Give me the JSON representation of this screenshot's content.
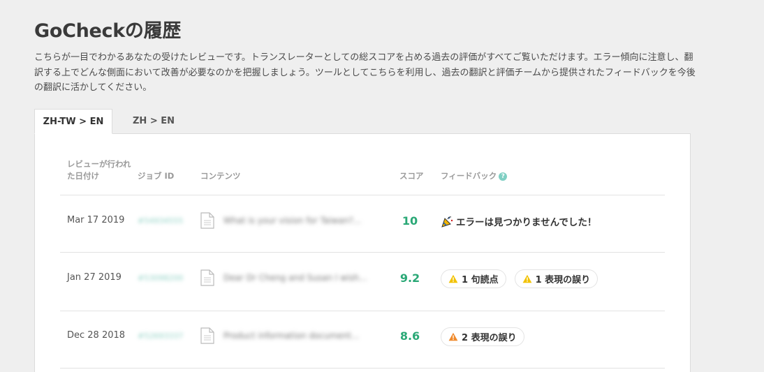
{
  "page": {
    "title": "GoCheckの履歴",
    "intro": "こちらが一目でわかるあなたの受けたレビューです。トランスレーターとしての総スコアを占める過去の評価がすべてご覧いただけます。エラー傾向に注意し、翻訳する上でどんな側面において改善が必要なのかを把握しましょう。ツールとしてこちらを利用し、過去の翻訳と評価チームから提供されたフィードバックを今後の翻訳に活かしてください。"
  },
  "tabs": [
    {
      "label": "ZH-TW > EN",
      "active": true
    },
    {
      "label": "ZH > EN",
      "active": false
    }
  ],
  "table": {
    "headers": {
      "date": "レビューが行われた日付け",
      "job_id": "ジョブ ID",
      "content": "コンテンツ",
      "score": "スコア",
      "feedback": "フィードバック"
    },
    "rows": [
      {
        "date": "Mar 17 2019",
        "job_id": "#54934555",
        "content": "What is your vision for Taiwan?...",
        "score": "10",
        "feedback_text": "エラーは見つかりませんでした！",
        "badges": []
      },
      {
        "date": "Jan 27 2019",
        "job_id": "#53098200",
        "content": "Dear Dr Cheng and Susan I wish...",
        "score": "9.2",
        "feedback_text": "",
        "badges": [
          {
            "label": "1 句読点",
            "level": "yellow"
          },
          {
            "label": "1 表現の誤り",
            "level": "yellow"
          }
        ]
      },
      {
        "date": "Dec 28 2018",
        "job_id": "#52693337",
        "content": "Product information document...",
        "score": "8.6",
        "feedback_text": "",
        "badges": [
          {
            "label": "2 表現の誤り",
            "level": "orange"
          }
        ]
      }
    ]
  },
  "colors": {
    "score": "#2aa876",
    "warn_yellow": "#f2c200",
    "warn_orange": "#f08a2c",
    "help_icon": "#7fcfc3"
  },
  "icons": {
    "celebrate": "party-popper-icon",
    "doc": "document-icon",
    "warn": "warning-triangle-icon",
    "help": "help-circle-icon"
  }
}
